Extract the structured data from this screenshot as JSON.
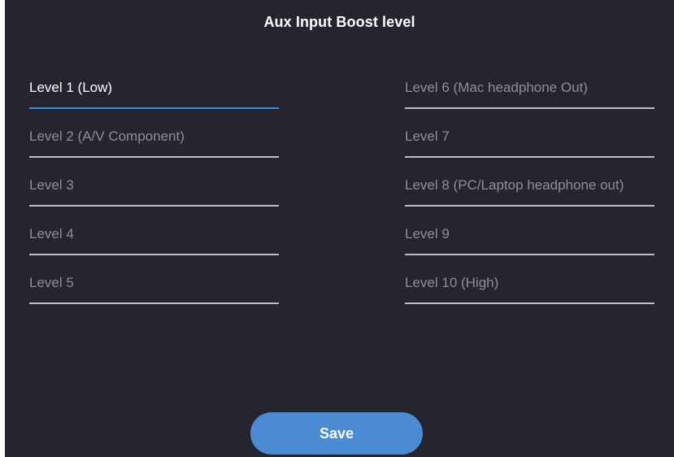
{
  "dialog": {
    "title": "Aux Input Boost level",
    "save_label": "Save"
  },
  "levels": {
    "left": [
      {
        "label": "Level 1 (Low)",
        "selected": true
      },
      {
        "label": "Level 2 (A/V Component)",
        "selected": false
      },
      {
        "label": "Level 3",
        "selected": false
      },
      {
        "label": "Level 4",
        "selected": false
      },
      {
        "label": "Level 5",
        "selected": false
      }
    ],
    "right": [
      {
        "label": "Level 6 (Mac headphone Out)",
        "selected": false
      },
      {
        "label": "Level 7",
        "selected": false
      },
      {
        "label": "Level 8 (PC/Laptop headphone out)",
        "selected": false
      },
      {
        "label": "Level 9",
        "selected": false
      },
      {
        "label": "Level 10 (High)",
        "selected": false
      }
    ]
  },
  "colors": {
    "background": "#25252f",
    "accent": "#3a8fe0",
    "button": "#4a8bd1",
    "inactive_text": "#8e8e95"
  }
}
